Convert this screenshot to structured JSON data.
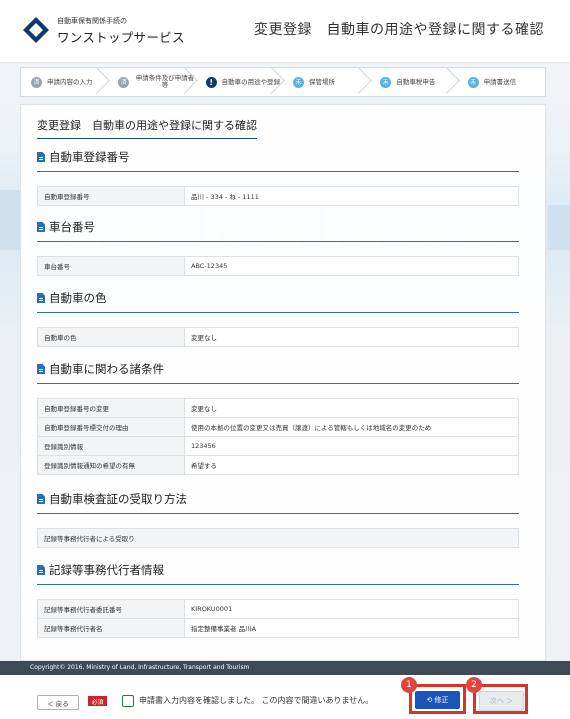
{
  "header": {
    "logo_small": "自動車保有関係手続の",
    "logo_big": "ワンストップサービス",
    "page_title": "変更登録　自動車の用途や登録に関する確認"
  },
  "steps": [
    {
      "num": "済",
      "label": "申請内容の入力",
      "state": "done"
    },
    {
      "num": "済",
      "label": "申請条件及び申請者等",
      "state": "done"
    },
    {
      "num": "!",
      "label": "自動車の用途や登録",
      "state": "current"
    },
    {
      "num": "未",
      "label": "保管場所",
      "state": "future"
    },
    {
      "num": "未",
      "label": "自動車税申告",
      "state": "future"
    },
    {
      "num": "未",
      "label": "申請書送信",
      "state": "future"
    }
  ],
  "main_title": "変更登録　自動車の用途や登録に関する確認",
  "sections": {
    "reg_number": {
      "title": "自動車登録番号",
      "rows": [
        {
          "k": "自動車登録番号",
          "v": "品川 - 334 - ね - 1111"
        }
      ]
    },
    "chassis": {
      "title": "車台番号",
      "rows": [
        {
          "k": "車台番号",
          "v": "ABC-12345"
        }
      ]
    },
    "color": {
      "title": "自動車の色",
      "rows": [
        {
          "k": "自動車の色",
          "v": "変更なし"
        }
      ]
    },
    "conditions": {
      "title": "自動車に関わる諸条件",
      "rows": [
        {
          "k": "自動車登録番号の変更",
          "v": "変更なし"
        },
        {
          "k": "自動車登録番号標交付の理由",
          "v": "使用の本拠の位置の変更又は売買（譲渡）による管轄もしくは地域名の変更のため"
        },
        {
          "k": "登録識別情報",
          "v": "123456"
        },
        {
          "k": "登録識別情報通知の希望の有無",
          "v": "希望する"
        }
      ]
    },
    "receipt": {
      "title": "自動車検査証の受取り方法",
      "value": "記録等事務代行者による受取り"
    },
    "agent": {
      "title": "記録等事務代行者情報",
      "rows": [
        {
          "k": "記録等事務代行者委託番号",
          "v": "KIROKU0001"
        },
        {
          "k": "記録等事務代行者名",
          "v": "指定整備事業者 品川A"
        }
      ]
    }
  },
  "footer": {
    "copyright": "Copyright© 2016, Ministry of Land, Infrastructure, Transport and Tourism"
  },
  "bottom": {
    "back": "＜ 戻る",
    "required": "必須",
    "confirm": "申請書入力内容を確認しました。 この内容で間違いありません。",
    "edit": "⟲ 修正",
    "next": "次へ ＞",
    "badge1": "1",
    "badge2": "2"
  },
  "colors": {
    "accent": "#1a56b8",
    "highlight": "#d8342c",
    "required": "#c8262c"
  }
}
